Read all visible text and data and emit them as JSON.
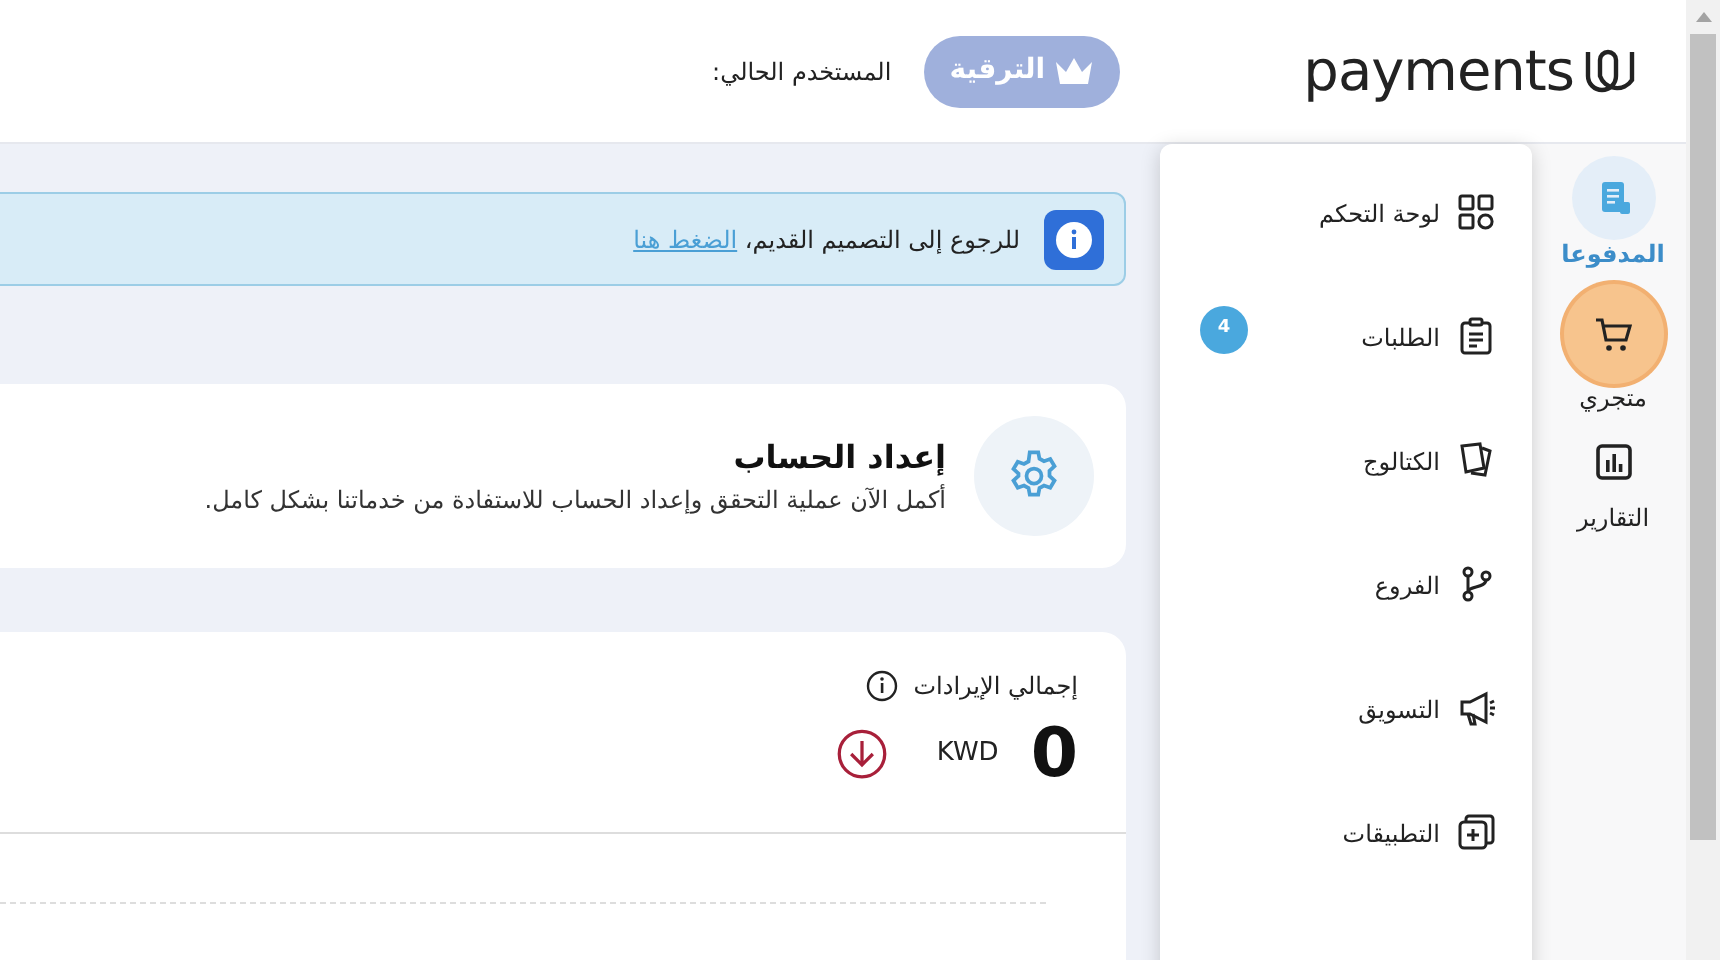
{
  "header": {
    "logo_text": "payments",
    "upgrade_button": "الترقية",
    "user_label": "المستخدم الحالي:"
  },
  "rail": [
    {
      "label": "المدفوعا",
      "selected": true,
      "highlighted": false
    },
    {
      "label": "متجري",
      "selected": false,
      "highlighted": true
    },
    {
      "label": "التقارير",
      "selected": false,
      "highlighted": false
    }
  ],
  "menu": [
    {
      "label": "لوحة التحكم"
    },
    {
      "label": "الطلبات",
      "badge": "4"
    },
    {
      "label": "الكتالوج"
    },
    {
      "label": "الفروع"
    },
    {
      "label": "التسويق"
    },
    {
      "label": "التطبيقات"
    }
  ],
  "alert": {
    "text": "للرجوع إلى التصميم القديم،",
    "link": "الضغط هنا"
  },
  "setup_card": {
    "title": "إعداد الحساب",
    "text": "أكمل الآن عملية التحقق وإعداد الحساب للاستفادة من خدماتنا بشكل كامل."
  },
  "revenue_card": {
    "title": "إجمالي الإيرادات",
    "value": "0",
    "currency": "KWD"
  }
}
